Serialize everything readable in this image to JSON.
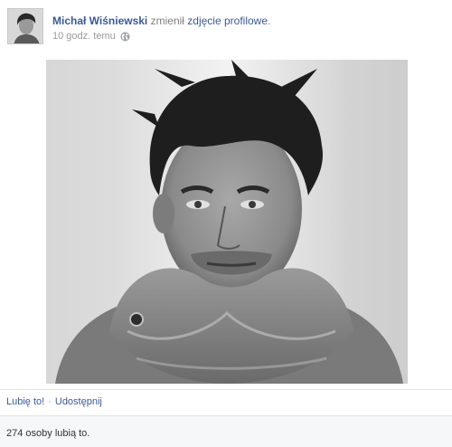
{
  "post": {
    "author": "Michał Wiśniewski",
    "action": "zmienił",
    "object": "zdjęcie profilowe",
    "period": ".",
    "timestamp": "10 godz. temu",
    "privacy_icon": "globe-icon"
  },
  "photo": {
    "description_icon": "profile-photo"
  },
  "actions": {
    "like_label": "Lubię to!",
    "separator": "·",
    "share_label": "Udostępnij"
  },
  "likes": {
    "text": "274 osoby lubią to."
  },
  "colors": {
    "link": "#3b5998",
    "muted": "#808080",
    "likes_bg": "#f6f7f9"
  }
}
